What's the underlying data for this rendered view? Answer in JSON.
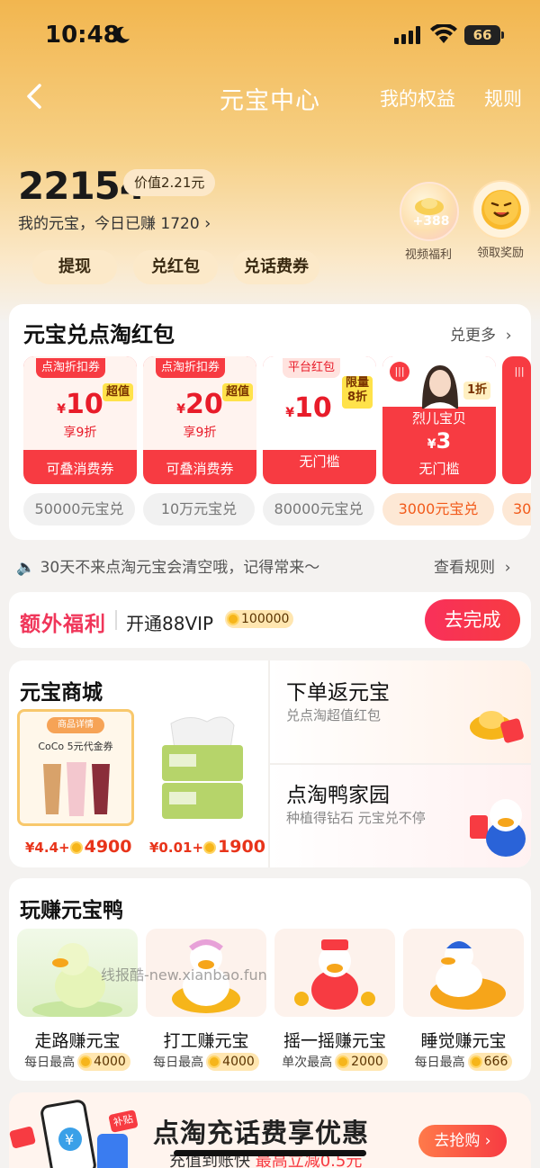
{
  "status_bar": {
    "time": "10:48",
    "battery": "66"
  },
  "nav": {
    "title": "元宝中心",
    "my_rights": "我的权益",
    "rules": "规则"
  },
  "account": {
    "balance": "22154",
    "value_badge": "价值2.21元",
    "today_text": "我的元宝，今日已赚 1720",
    "actions": [
      "提现",
      "兑红包",
      "兑话费券"
    ]
  },
  "rewards": [
    {
      "amount": "+388",
      "label": "视频福利"
    },
    {
      "label": "领取奖励"
    }
  ],
  "exchange": {
    "title": "元宝兑点淘红包",
    "more": "兑更多",
    "coupons": [
      {
        "tag": "点淘折扣券",
        "badge": "超值",
        "currency": "¥",
        "amount": "10",
        "discount": "享9折",
        "bottom": "可叠消费券",
        "price": "50000元宝兑"
      },
      {
        "tag": "点淘折扣券",
        "badge": "超值",
        "currency": "¥",
        "amount": "20",
        "discount": "享9折",
        "bottom": "可叠消费券",
        "price": "10万元宝兑"
      },
      {
        "tag": "平台红包",
        "badge": "限量\n8折",
        "currency": "¥",
        "amount": "10",
        "bottom": "无门槛",
        "price": "80000元宝兑"
      },
      {
        "badge": "1折",
        "host": "烈儿宝贝",
        "currency": "¥",
        "amount": "3",
        "bottom": "无门槛",
        "price": "3000元宝兑"
      }
    ]
  },
  "notice": {
    "text": "30天不来点淘元宝会清空哦，记得常来～",
    "link": "查看规则"
  },
  "bonus": {
    "label": "额外福利",
    "task": "开通88VIP",
    "reward": "100000",
    "button": "去完成"
  },
  "mall": {
    "title": "元宝商城",
    "products": [
      {
        "badge": "商品详情",
        "name": "CoCo 5元代金券",
        "cash": "¥4.4",
        "coins": "4900"
      },
      {
        "cash": "¥0.01",
        "coins": "1900"
      }
    ],
    "order": {
      "title": "下单返元宝",
      "subtitle": "兑点淘超值红包"
    },
    "garden": {
      "title": "点淘鸭家园",
      "subtitle": "种植得钻石 元宝兑不停"
    }
  },
  "play": {
    "title": "玩赚元宝鸭",
    "games": [
      {
        "title": "走路赚元宝",
        "prefix": "每日最高",
        "coins": "4000"
      },
      {
        "title": "打工赚元宝",
        "prefix": "每日最高",
        "coins": "4000"
      },
      {
        "title": "摇一摇赚元宝",
        "prefix": "单次最高",
        "coins": "2000"
      },
      {
        "title": "睡觉赚元宝",
        "prefix": "每日最高",
        "coins": "666"
      }
    ],
    "watermark": "线报酷-new.xianbao.fun"
  },
  "promo": {
    "title": "点淘充话费享优惠",
    "subtitle": "充值到账快",
    "highlight": "最高立减0.5元",
    "button": "去抢购",
    "tag": "补贴"
  },
  "colors": {
    "accent": "#f73b42",
    "gold": "#f6b51a",
    "header_top": "#f2b64f"
  }
}
